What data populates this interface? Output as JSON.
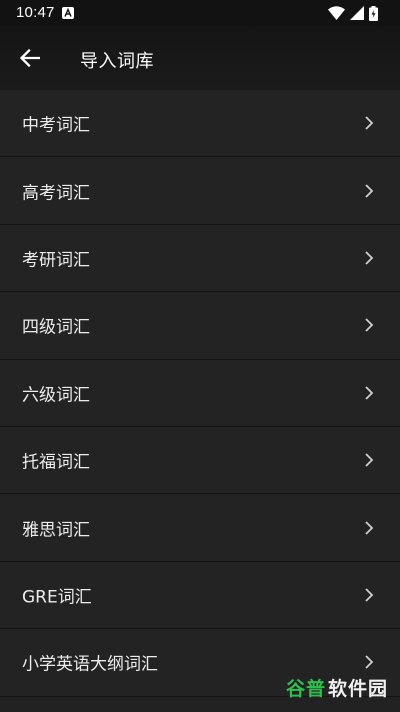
{
  "status_bar": {
    "time": "10:47",
    "icons": [
      "notification-a-icon",
      "wifi-icon",
      "signal-icon",
      "battery-icon"
    ]
  },
  "app_bar": {
    "title": "导入词库",
    "back_icon": "arrow-left-icon"
  },
  "list": {
    "items": [
      {
        "label": "中考词汇"
      },
      {
        "label": "高考词汇"
      },
      {
        "label": "考研词汇"
      },
      {
        "label": "四级词汇"
      },
      {
        "label": "六级词汇"
      },
      {
        "label": "托福词汇"
      },
      {
        "label": "雅思词汇"
      },
      {
        "label": "GRE词汇"
      },
      {
        "label": "小学英语大纲词汇"
      }
    ],
    "chevron_icon": "chevron-right-icon"
  },
  "watermark": {
    "part1": "谷普",
    "part2": "软件园"
  },
  "colors": {
    "background": "#222222",
    "status_bar": "#121212",
    "app_bar": "#1b1b1b",
    "text": "#ececec",
    "watermark_green": "#2fbf4f"
  }
}
